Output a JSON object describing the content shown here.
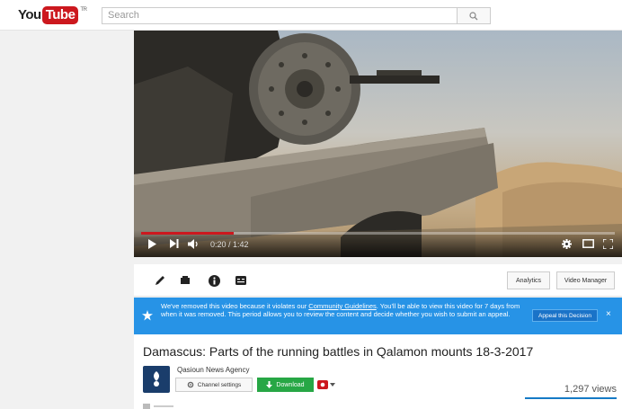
{
  "header": {
    "logo_you": "You",
    "logo_tube": "Tube",
    "logo_tm": "TR",
    "search_placeholder": "Search"
  },
  "player": {
    "time": "0:20 / 1:42",
    "progress_fraction": 0.196
  },
  "actions": {
    "analytics_label": "Analytics",
    "video_manager_label": "Video Manager"
  },
  "notice": {
    "text_before_link": "We've removed this video because it violates our ",
    "link_text": "Community Guidelines",
    "text_after_link": ". You'll be able to view this video for 7 days from when it was removed. This period allows you to review the content and decide whether you wish to submit an appeal.",
    "appeal_label": "Appeal this Decision",
    "close_label": "×"
  },
  "video": {
    "title": "Damascus: Parts of the running battles in Qalamon mounts 18-3-2017",
    "channel_name": "Qasioun News Agency",
    "channel_settings_label": "Channel settings",
    "download_label": "Download",
    "views": "1,297 views"
  },
  "colors": {
    "brand_red": "#cc181e",
    "notice_blue": "#2793e6",
    "download_green": "#27a745"
  }
}
